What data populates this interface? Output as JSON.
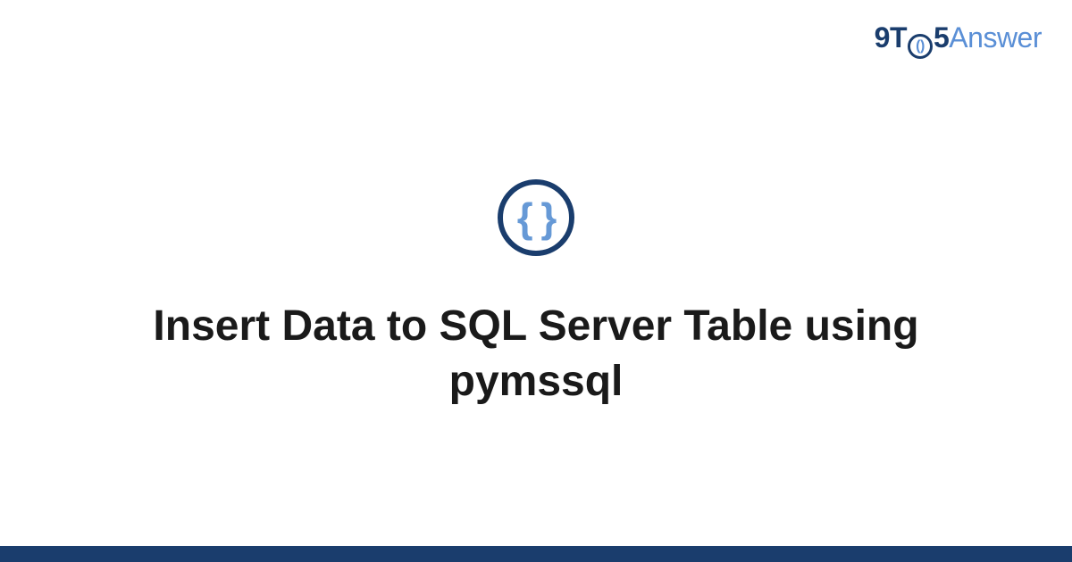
{
  "brand": {
    "part1": "9T",
    "clock_inner": "()",
    "part2": "5",
    "part3": "Answer"
  },
  "icon": {
    "name": "code-braces-icon",
    "glyph": "{ }"
  },
  "title": "Insert Data to SQL Server Table using pymssql",
  "colors": {
    "dark_blue": "#1a3d6d",
    "light_blue": "#5a8fd6",
    "brace_blue": "#6699d6"
  }
}
